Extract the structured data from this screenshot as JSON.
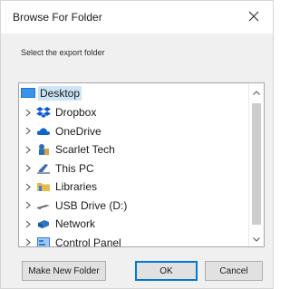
{
  "window": {
    "title": "Browse For Folder",
    "close_icon": "close-icon"
  },
  "instruction": "Select the export folder",
  "tree": {
    "root": {
      "label": "Desktop",
      "icon": "desktop-icon",
      "selected": true
    },
    "items": [
      {
        "label": "Dropbox",
        "icon": "dropbox-icon"
      },
      {
        "label": "OneDrive",
        "icon": "cloud-icon"
      },
      {
        "label": "Scarlet Tech",
        "icon": "user-icon"
      },
      {
        "label": "This PC",
        "icon": "computer-icon"
      },
      {
        "label": "Libraries",
        "icon": "folder-icon"
      },
      {
        "label": "USB Drive (D:)",
        "icon": "usb-drive-icon"
      },
      {
        "label": "Network",
        "icon": "network-icon"
      },
      {
        "label": "Control Panel",
        "icon": "control-panel-icon"
      }
    ]
  },
  "buttons": {
    "new_folder": "Make New Folder",
    "ok": "OK",
    "cancel": "Cancel"
  },
  "colors": {
    "selection": "#cce4f7",
    "accent": "#0078d7",
    "dialog_bg": "#f0f0f0"
  }
}
